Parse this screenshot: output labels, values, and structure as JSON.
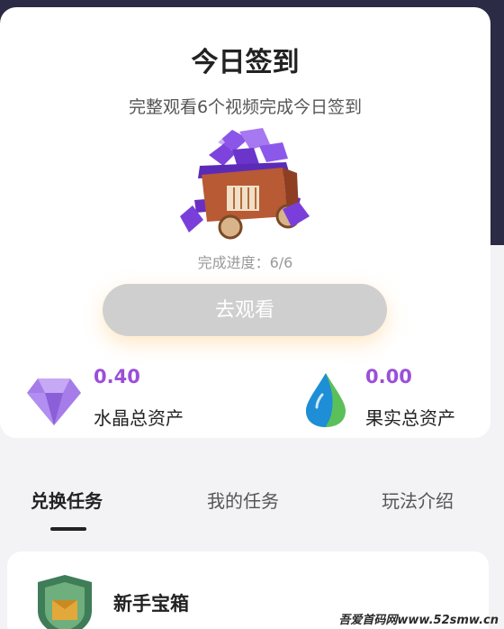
{
  "checkin": {
    "title": "今日签到",
    "subtitle": "完整观看6个视频完成今日签到",
    "progress_text": "完成进度：6/6",
    "progress_value": 1.0,
    "watch_button": "去观看"
  },
  "assets": [
    {
      "value": "0.40",
      "label": "水晶总资产",
      "icon": "crystal-icon"
    },
    {
      "value": "0.00",
      "label": "果实总资产",
      "icon": "water-drop-icon"
    }
  ],
  "tabs": [
    {
      "label": "兑换任务",
      "active": true
    },
    {
      "label": "我的任务",
      "active": false
    },
    {
      "label": "玩法介绍",
      "active": false
    }
  ],
  "task": {
    "title": "新手宝箱",
    "icon": "treasure-badge-icon"
  },
  "watermark": "吾爱首码网www.52smw.cn",
  "colors": {
    "accent": "#9b4fd6",
    "button_disabled": "#cfcfcf",
    "header_bg": "#2b2b45"
  }
}
